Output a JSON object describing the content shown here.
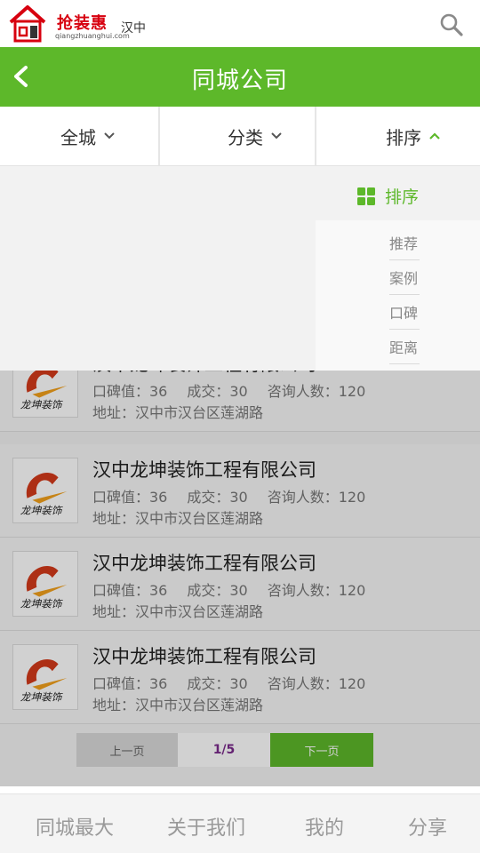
{
  "brand": {
    "name": "抢装惠",
    "url": "qiangzhuanghui.com",
    "city": "汉中",
    "accent": "#d7000f"
  },
  "header": {
    "title": "同城公司",
    "accent": "#5db82a"
  },
  "filters": [
    {
      "label": "全城",
      "icon": "chevron-down-icon"
    },
    {
      "label": "分类",
      "icon": "chevron-down-icon"
    },
    {
      "label": "排序",
      "icon": "chevron-up-icon",
      "active": true
    }
  ],
  "sort_dropdown": {
    "heading": "排序",
    "icon": "grid-icon",
    "options": [
      "推荐",
      "案例",
      "口碑",
      "距离"
    ]
  },
  "companies": [
    {
      "name": "汉中龙坤装饰工程有限公司",
      "rating": "口碑值：36",
      "deals": "成交：30",
      "inquiries": "咨询人数：120",
      "address": "地址：汉中市汉台区莲湖路",
      "logo_text": "龙坤装饰"
    },
    {
      "name": "汉中龙坤装饰工程有限公司",
      "rating": "口碑值：36",
      "deals": "成交：30",
      "inquiries": "咨询人数：120",
      "address": "地址：汉中市汉台区莲湖路",
      "logo_text": "龙坤装饰"
    },
    {
      "name": "汉中龙坤装饰工程有限公司",
      "rating": "口碑值：36",
      "deals": "成交：30",
      "inquiries": "咨询人数：120",
      "address": "地址：汉中市汉台区莲湖路",
      "logo_text": "龙坤装饰"
    },
    {
      "name": "汉中龙坤装饰工程有限公司",
      "rating": "口碑值：36",
      "deals": "成交：30",
      "inquiries": "咨询人数：120",
      "address": "地址：汉中市汉台区莲湖路",
      "logo_text": "龙坤装饰"
    }
  ],
  "pagination": {
    "prev": "上一页",
    "page": "1/5",
    "next": "下一页"
  },
  "bottom_nav": [
    "同城最大",
    "关于我们",
    "我的",
    "分享"
  ]
}
